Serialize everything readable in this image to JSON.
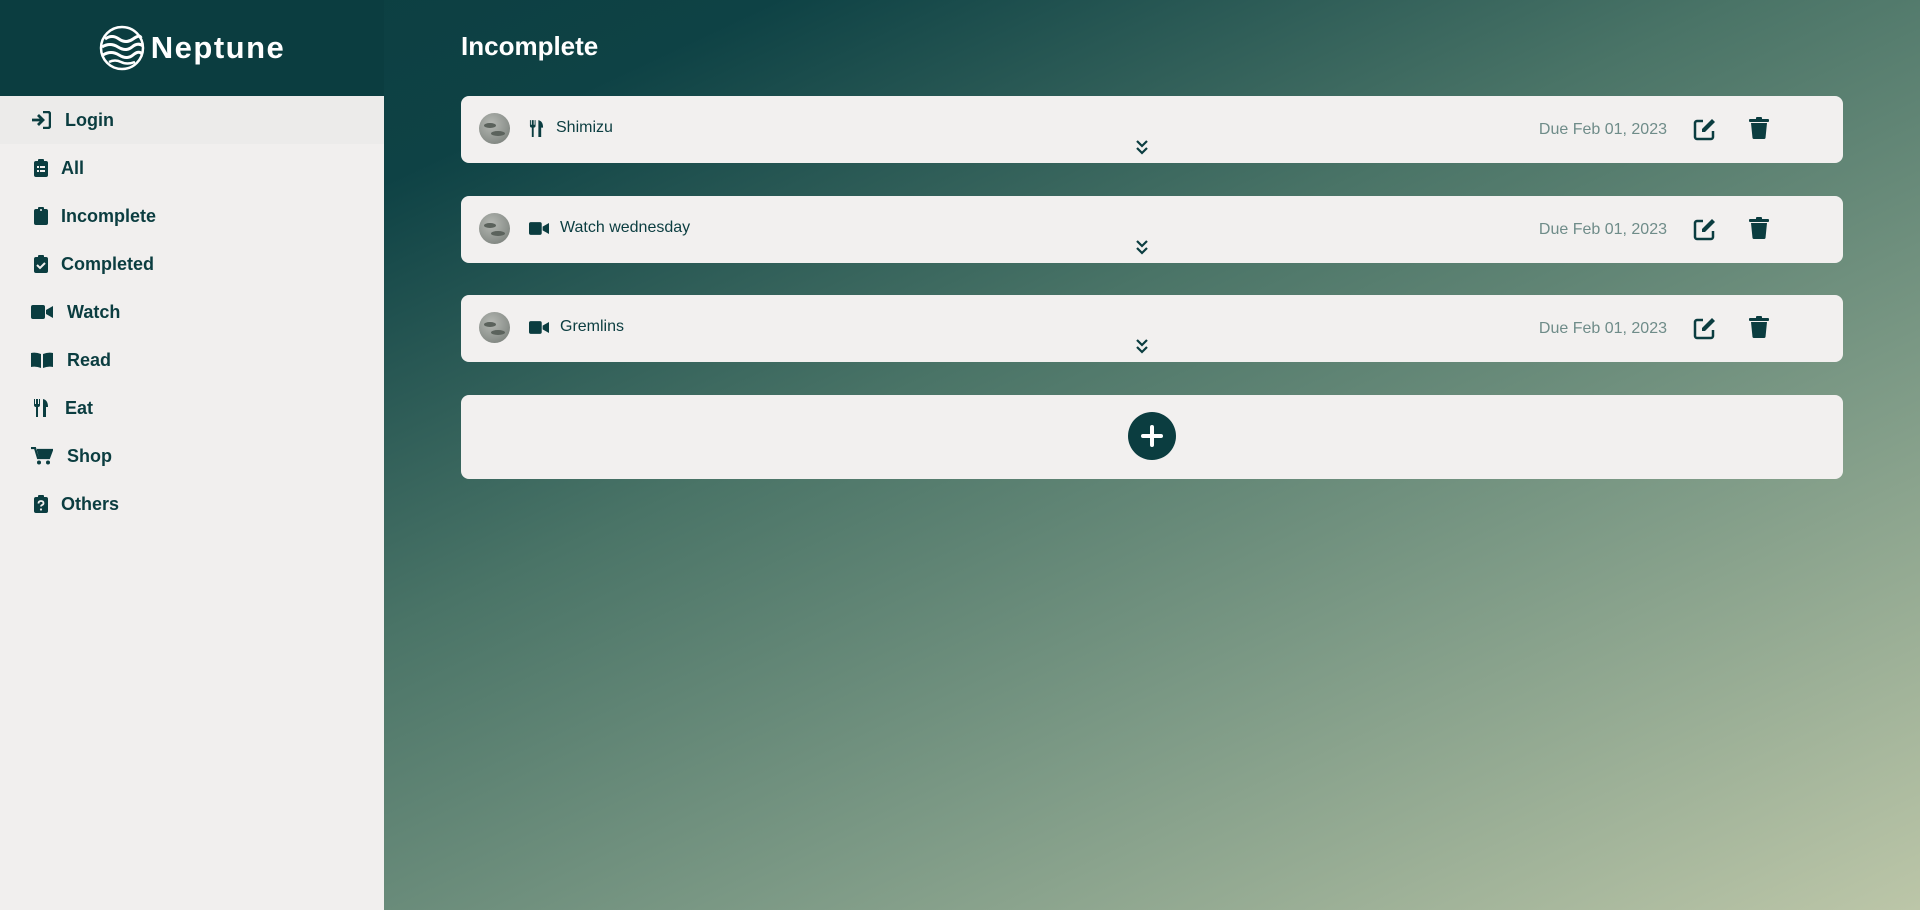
{
  "brand": {
    "name": "Neptune",
    "logo_icon": "neptune-planet-logo"
  },
  "colors": {
    "primary": "#0b3d40",
    "sidebar_bg": "#f1efee",
    "card_bg": "#f2f0ef",
    "due_text": "#6f8c89"
  },
  "sidebar": {
    "items": [
      {
        "label": "Login",
        "icon": "sign-in-icon"
      },
      {
        "label": "All",
        "icon": "clipboard-list-icon"
      },
      {
        "label": "Incomplete",
        "icon": "clipboard-icon"
      },
      {
        "label": "Completed",
        "icon": "clipboard-check-icon"
      },
      {
        "label": "Watch",
        "icon": "video-icon"
      },
      {
        "label": "Read",
        "icon": "book-open-icon"
      },
      {
        "label": "Eat",
        "icon": "utensils-icon"
      },
      {
        "label": "Shop",
        "icon": "shopping-cart-icon"
      },
      {
        "label": "Others",
        "icon": "clipboard-question-icon"
      }
    ]
  },
  "main": {
    "title": "Incomplete",
    "tasks": [
      {
        "title": "Shimizu",
        "category_icon": "utensils-icon",
        "due": "Due Feb 01, 2023"
      },
      {
        "title": "Watch wednesday",
        "category_icon": "video-icon",
        "due": "Due Feb 01, 2023"
      },
      {
        "title": "Gremlins",
        "category_icon": "video-icon",
        "due": "Due Feb 01, 2023"
      }
    ],
    "add_icon": "plus-icon"
  }
}
